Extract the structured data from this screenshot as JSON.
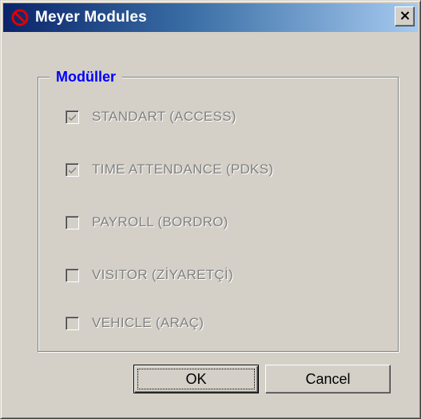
{
  "window": {
    "title": "Meyer Modules",
    "icon": "prohibited-icon"
  },
  "titlebar": {
    "close_icon": "close-icon",
    "gradient_start": "#0a246a",
    "gradient_end": "#a6caf0"
  },
  "group": {
    "legend": "Modüller",
    "legend_color": "#0000ff"
  },
  "modules": [
    {
      "label": "STANDART (ACCESS)",
      "checked": true,
      "enabled": false
    },
    {
      "label": "TIME ATTENDANCE (PDKS)",
      "checked": true,
      "enabled": false
    },
    {
      "label": "PAYROLL (BORDRO)",
      "checked": false,
      "enabled": false
    },
    {
      "label": "VISITOR (ZİYARETÇİ)",
      "checked": false,
      "enabled": false
    },
    {
      "label": "VEHICLE (ARAÇ)",
      "checked": false,
      "enabled": false
    }
  ],
  "buttons": {
    "ok_label": "OK",
    "cancel_label": "Cancel"
  }
}
